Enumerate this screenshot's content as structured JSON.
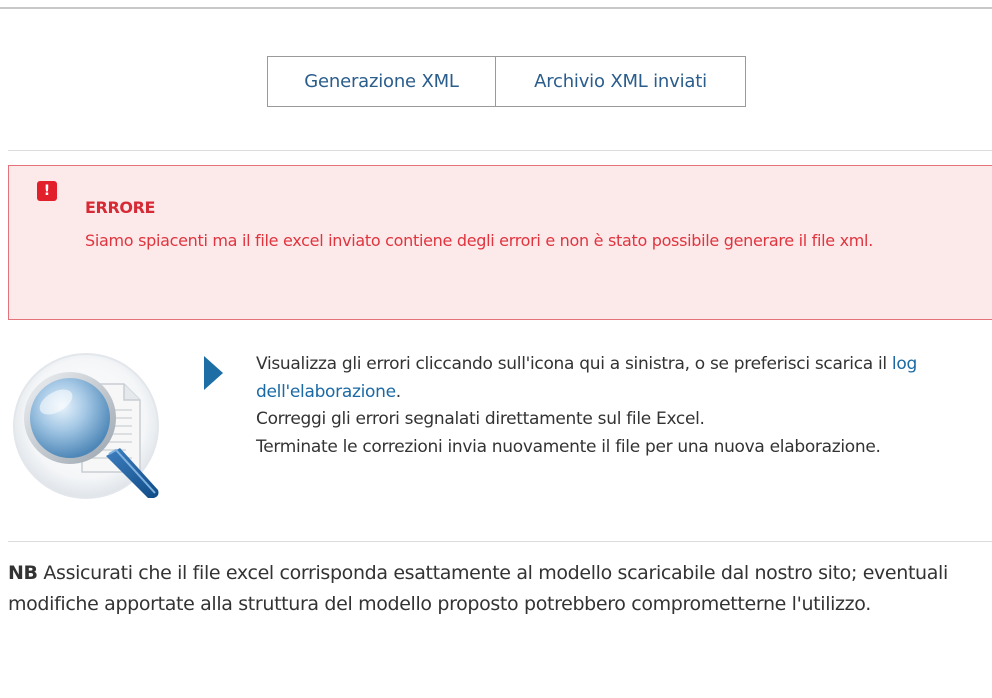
{
  "tabs": {
    "generation": "Generazione XML",
    "archive": "Archivio XML inviati"
  },
  "error": {
    "icon_symbol": "!",
    "title": "ERRORE",
    "message": "Siamo spiacenti ma il file excel inviato contiene degli errori e non è stato possibile generare il file xml."
  },
  "info": {
    "icon": "magnifier-document-icon",
    "line1_before": "Visualizza gli errori cliccando sull'icona qui a sinistra, o se preferisci scarica il ",
    "log_link": "log dell'elaborazione",
    "line1_after": ".",
    "line2": "Correggi gli errori segnalati direttamente sul file Excel.",
    "line3": "Terminate le correzioni invia nuovamente il file per una nuova elaborazione."
  },
  "note": {
    "label": "NB",
    "text": " Assicurati che il file excel corrisponda esattamente al modello scaricabile dal nostro sito; eventuali modifiche apportate alla struttura del modello proposto potrebbero comprometterne l'utilizzo."
  },
  "colors": {
    "link": "#2a5d8c",
    "error_bg": "#fce9ea",
    "error_border": "#e3727b",
    "error_text": "#e0343e",
    "error_icon": "#e2202c",
    "arrow": "#1c6ea4"
  }
}
